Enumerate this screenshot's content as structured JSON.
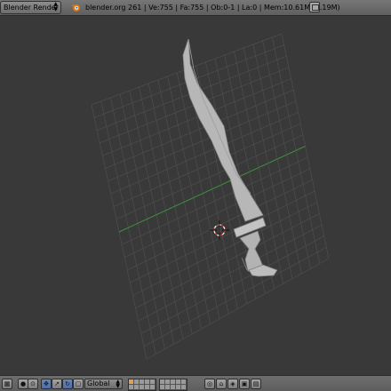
{
  "header": {
    "render_engine": "Blender Render",
    "stats": "blender.org 261 | Ve:755 | Fa:755 | Ob:0-1 | La:0 | Mem:10.61M (1.19M)"
  },
  "viewport": {
    "object": "sword mesh",
    "grid_color": "#4e4e4e",
    "background_color": "#393939",
    "x_axis_color": "#3f8f3f",
    "mesh_color": "#b5b5b5"
  },
  "footer": {
    "orientation": "Global",
    "layer_states": [
      true,
      false,
      false,
      false,
      false,
      false,
      false,
      false,
      false,
      false
    ]
  },
  "icons": {
    "editor_type": "3d-view-icon",
    "pivot": "pivot-icon",
    "manipulator_translate": "translate-icon",
    "manipulator_rotate": "rotate-icon",
    "manipulator_scale": "scale-icon",
    "lock_camera": "lock-icon",
    "render": "render-icon",
    "screen": "screen-layout-icon"
  }
}
